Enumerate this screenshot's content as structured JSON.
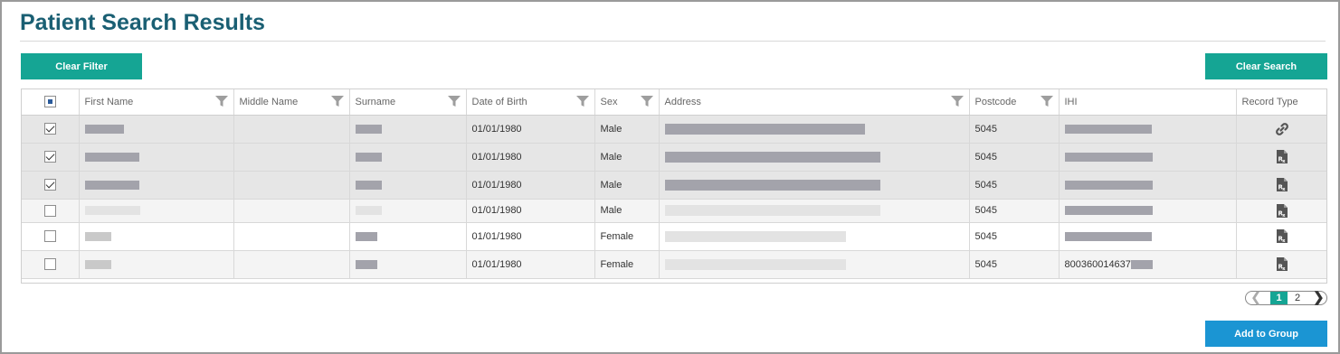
{
  "page_title": "Patient Search Results",
  "buttons": {
    "clear_filter": "Clear Filter",
    "clear_search": "Clear Search",
    "add_to_group": "Add to Group"
  },
  "table": {
    "columns": [
      "First Name",
      "Middle Name",
      "Surname",
      "Date of Birth",
      "Sex",
      "Address",
      "Postcode",
      "IHI",
      "Record Type"
    ],
    "select_all_state": "partial",
    "rows": [
      {
        "checked": true,
        "dob": "01/01/1980",
        "sex": "Male",
        "postcode": "5045",
        "ihi": "",
        "record_type": "link-icon"
      },
      {
        "checked": true,
        "dob": "01/01/1980",
        "sex": "Male",
        "postcode": "5045",
        "ihi": "",
        "record_type": "prescription-icon"
      },
      {
        "checked": true,
        "dob": "01/01/1980",
        "sex": "Male",
        "postcode": "5045",
        "ihi": "",
        "record_type": "prescription-icon"
      },
      {
        "checked": false,
        "dob": "01/01/1980",
        "sex": "Male",
        "postcode": "5045",
        "ihi": "",
        "record_type": "prescription-icon"
      },
      {
        "checked": false,
        "dob": "01/01/1980",
        "sex": "Female",
        "postcode": "5045",
        "ihi": "",
        "record_type": "prescription-icon"
      },
      {
        "checked": false,
        "dob": "01/01/1980",
        "sex": "Female",
        "postcode": "5045",
        "ihi": "800360014637",
        "record_type": "prescription-icon"
      }
    ]
  },
  "pagination": {
    "current_page": "1",
    "next_page": "2"
  },
  "colors": {
    "title": "#1a5f73",
    "teal_button": "#15a594",
    "blue_button": "#1b95d3",
    "redaction": "#a3a3ab"
  }
}
